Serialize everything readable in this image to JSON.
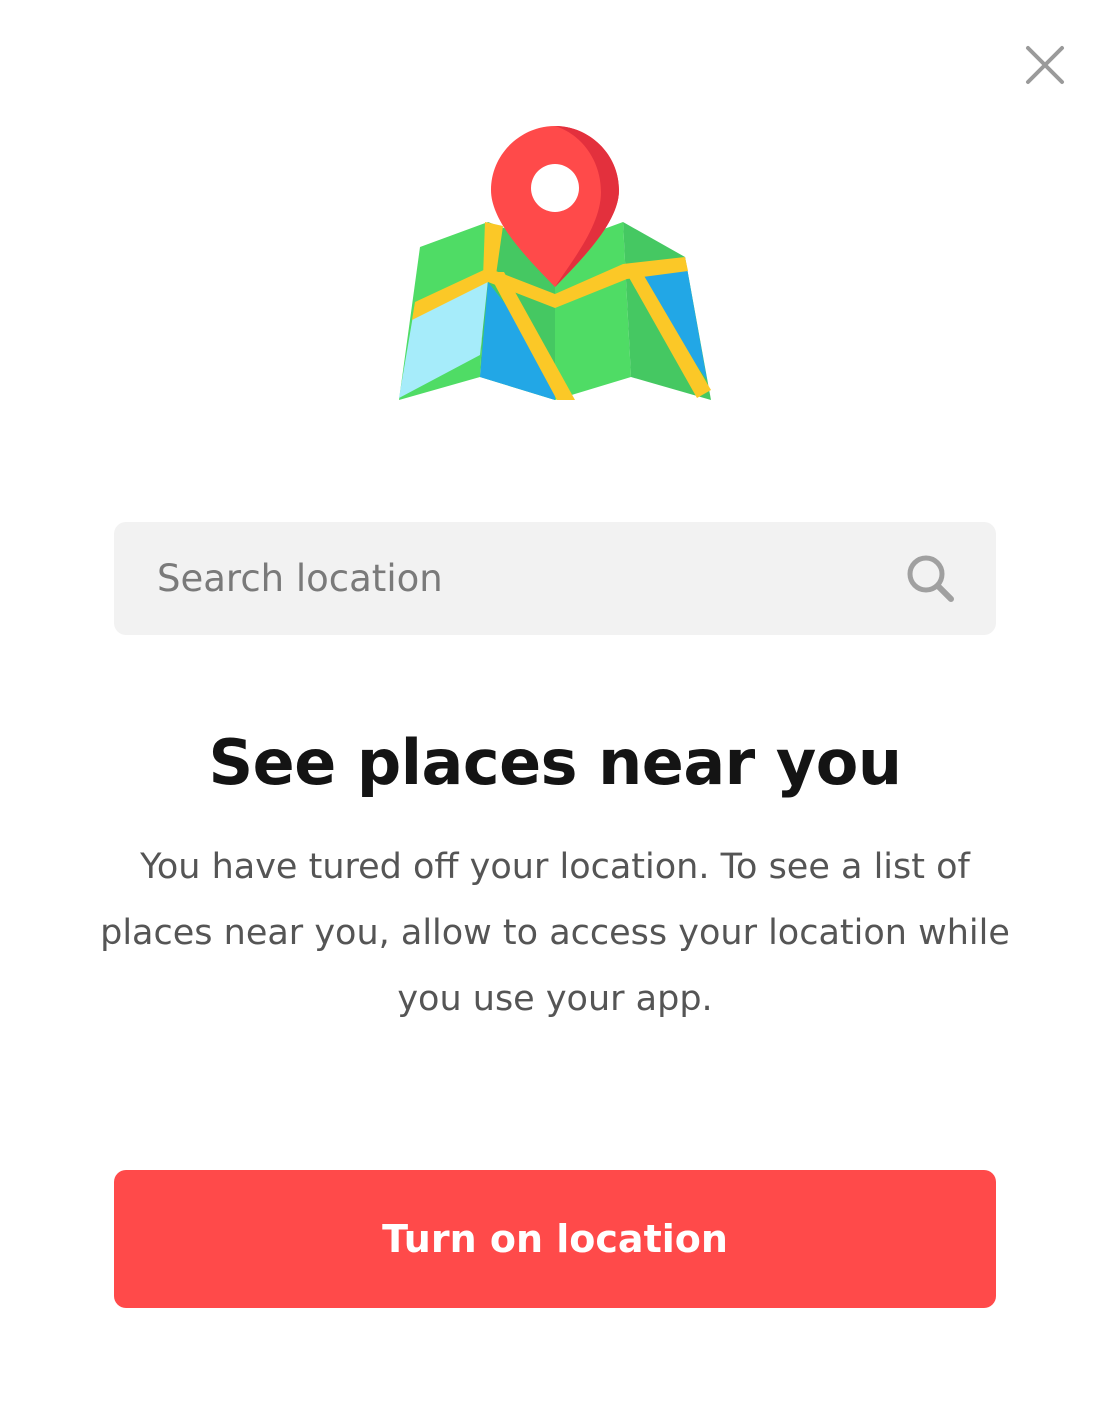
{
  "modal": {
    "close_icon": "close-icon",
    "illustration_icon": "folded-map-with-location-pin-icon"
  },
  "search": {
    "placeholder": "Search location",
    "value": "",
    "icon": "search-icon"
  },
  "content": {
    "title": "See places near you",
    "description": "You have tured off your location. To see a list of places near you, allow to access your location while you use your app."
  },
  "actions": {
    "primary_label": "Turn on location"
  },
  "colors": {
    "accent": "#FF4A4A",
    "title": "#141414",
    "body_text": "#555555",
    "search_background": "#F2F2F2",
    "placeholder": "#7A7A7A",
    "icon_gray": "#A0A0A0"
  }
}
